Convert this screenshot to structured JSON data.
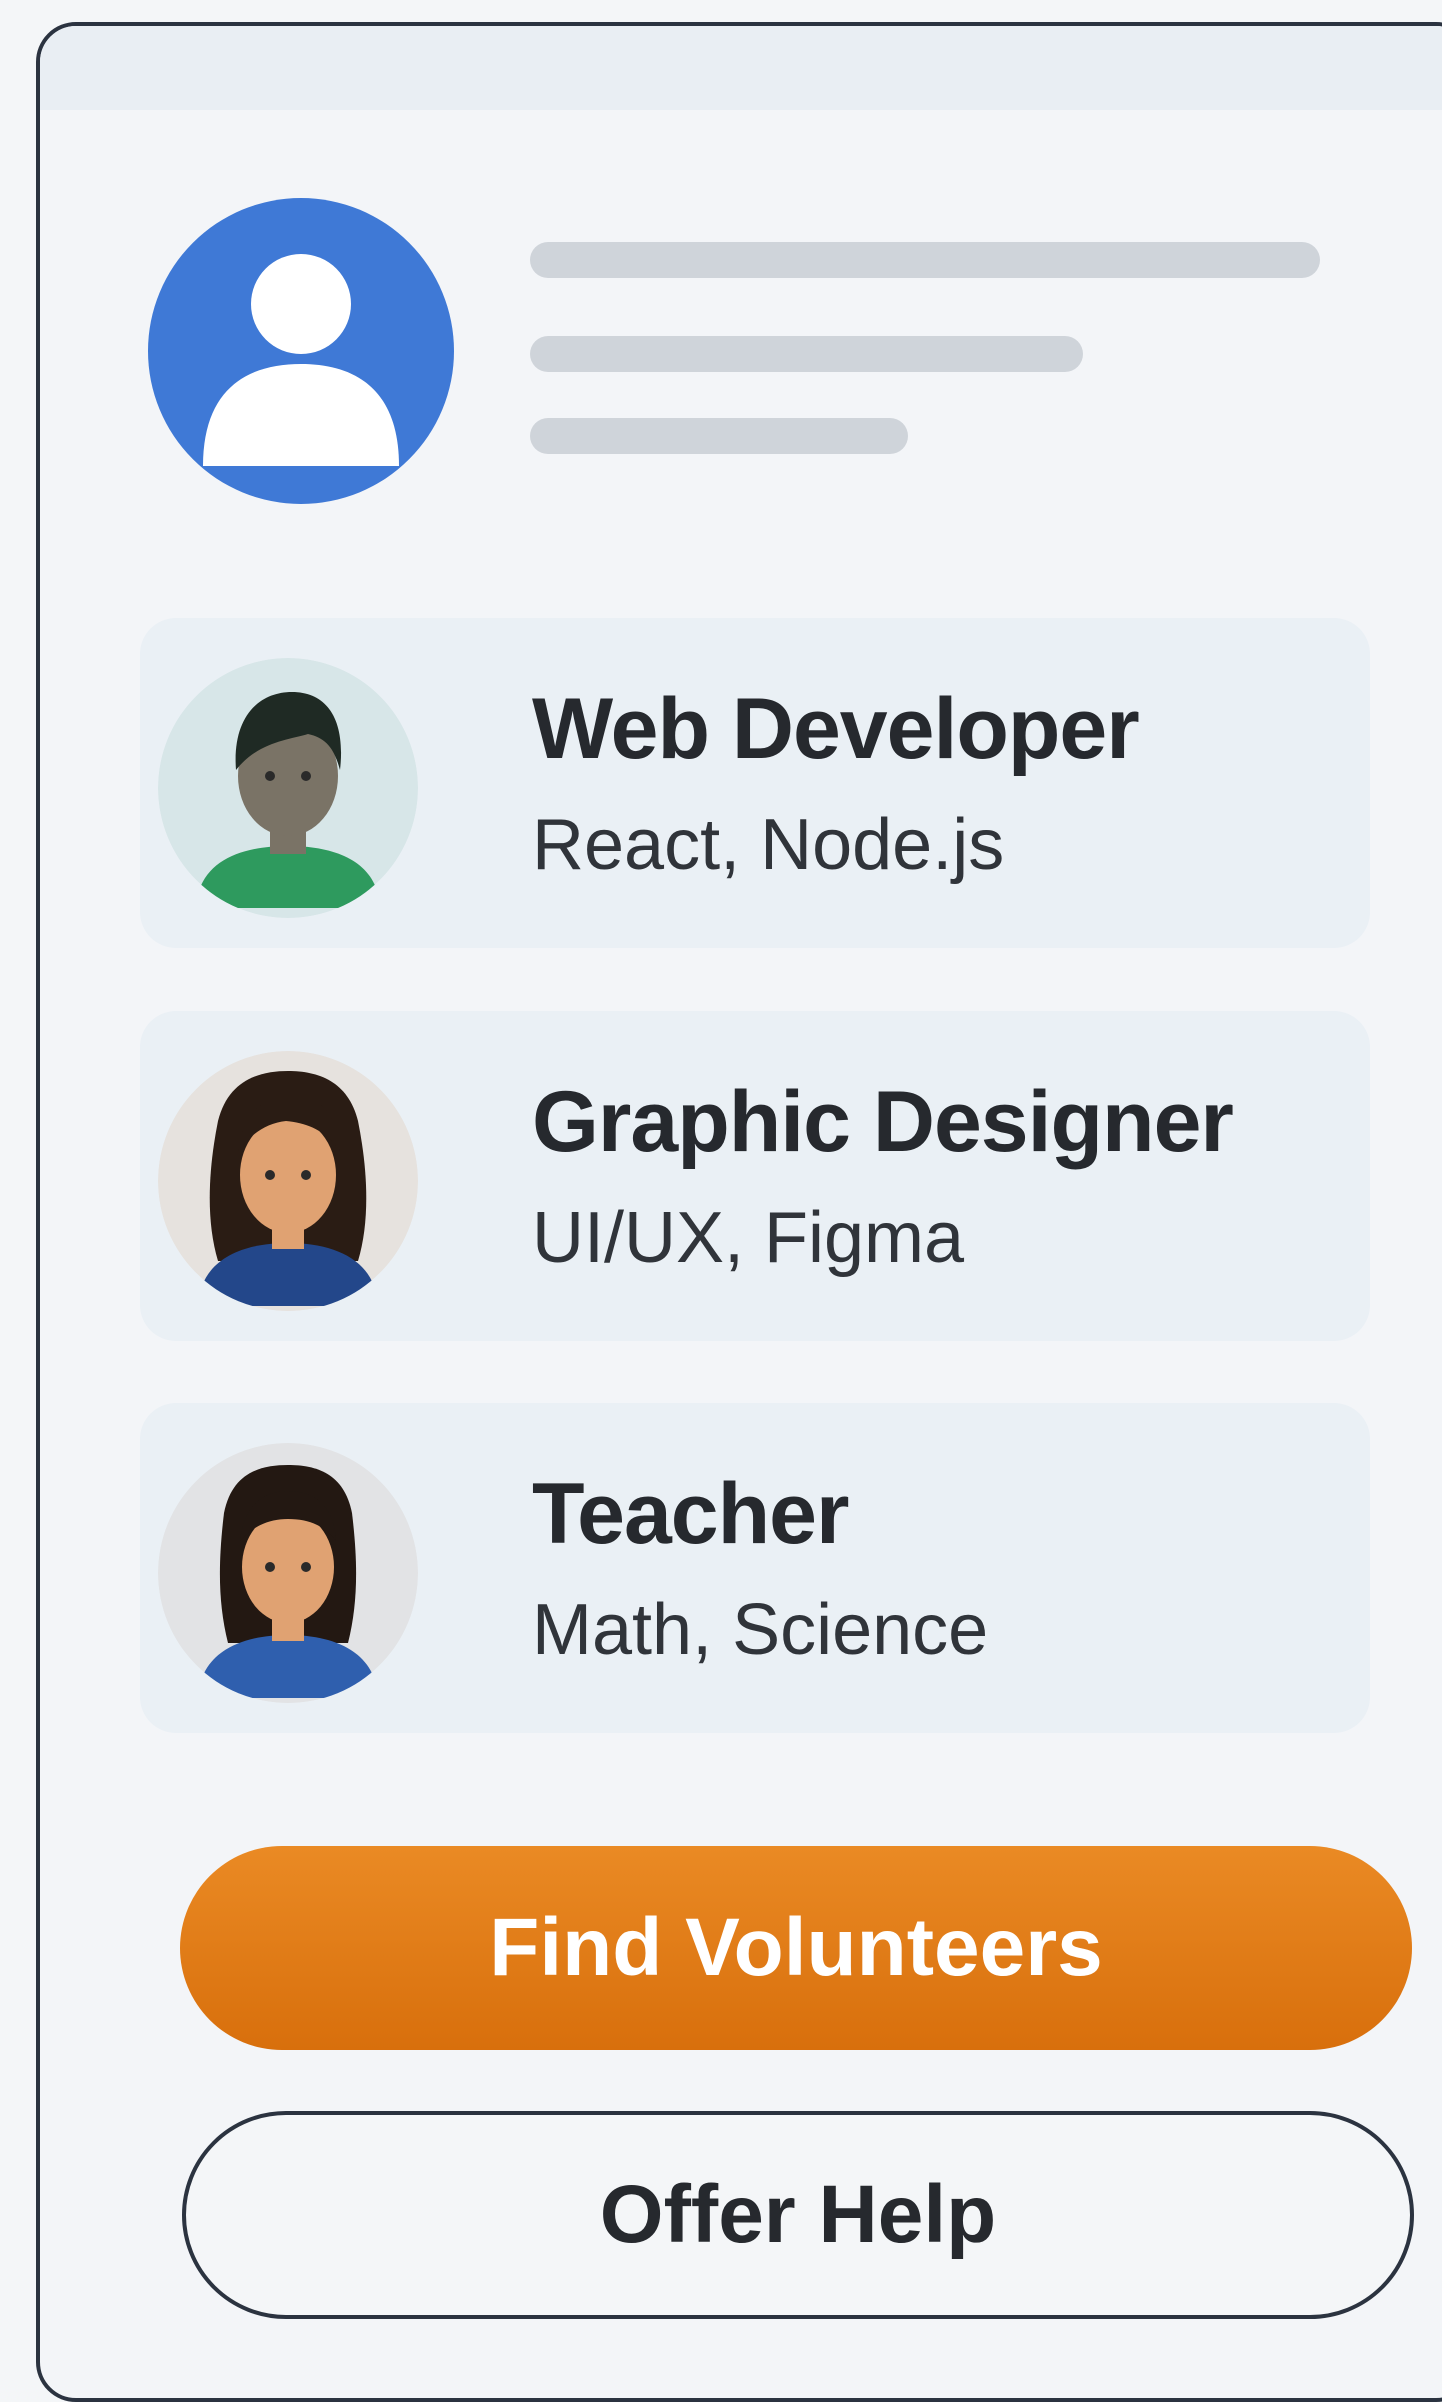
{
  "profile": {
    "avatar_icon": "user-avatar-icon",
    "accent_color": "#3f79d6"
  },
  "volunteers": [
    {
      "title": "Web Developer",
      "skills": "React, Node.js",
      "avatar_icon": "male-avatar-icon"
    },
    {
      "title": "Graphic Designer",
      "skills": "UI/UX, Figma",
      "avatar_icon": "female-avatar-icon"
    },
    {
      "title": "Teacher",
      "skills": "Math, Science",
      "avatar_icon": "female-avatar-icon"
    }
  ],
  "actions": {
    "find_label": "Find Volunteers",
    "offer_label": "Offer Help",
    "primary_color": "#e07a14"
  }
}
